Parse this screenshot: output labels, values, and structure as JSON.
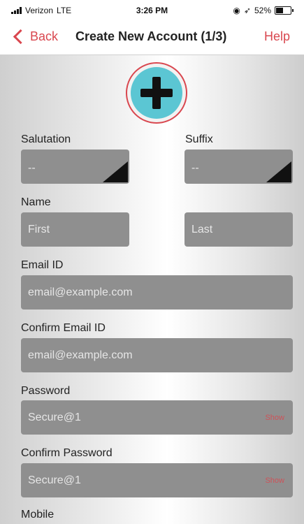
{
  "status_bar": {
    "carrier": "Verizon",
    "network": "LTE",
    "time": "3:26 PM",
    "battery": "52%",
    "battery_level": 0.52
  },
  "nav": {
    "back_label": "Back",
    "title": "Create New Account (1/3)",
    "help_label": "Help"
  },
  "avatar": {
    "icon": "plus-icon"
  },
  "form": {
    "salutation": {
      "label": "Salutation",
      "value": "--"
    },
    "suffix": {
      "label": "Suffix",
      "value": "--"
    },
    "name": {
      "label": "Name",
      "first_placeholder": "First",
      "last_placeholder": "Last"
    },
    "email": {
      "label": "Email ID",
      "placeholder": "email@example.com"
    },
    "confirm_email": {
      "label": "Confirm Email ID",
      "placeholder": "email@example.com"
    },
    "password": {
      "label": "Password",
      "value": "Secure@1",
      "show_label": "Show"
    },
    "confirm_password": {
      "label": "Confirm Password",
      "value": "Secure@1",
      "show_label": "Show"
    },
    "mobile": {
      "label": "Mobile"
    }
  },
  "colors": {
    "accent": "#d9474f",
    "avatar_fill": "#5bc6d3",
    "field_bg": "#8f8f8f"
  }
}
